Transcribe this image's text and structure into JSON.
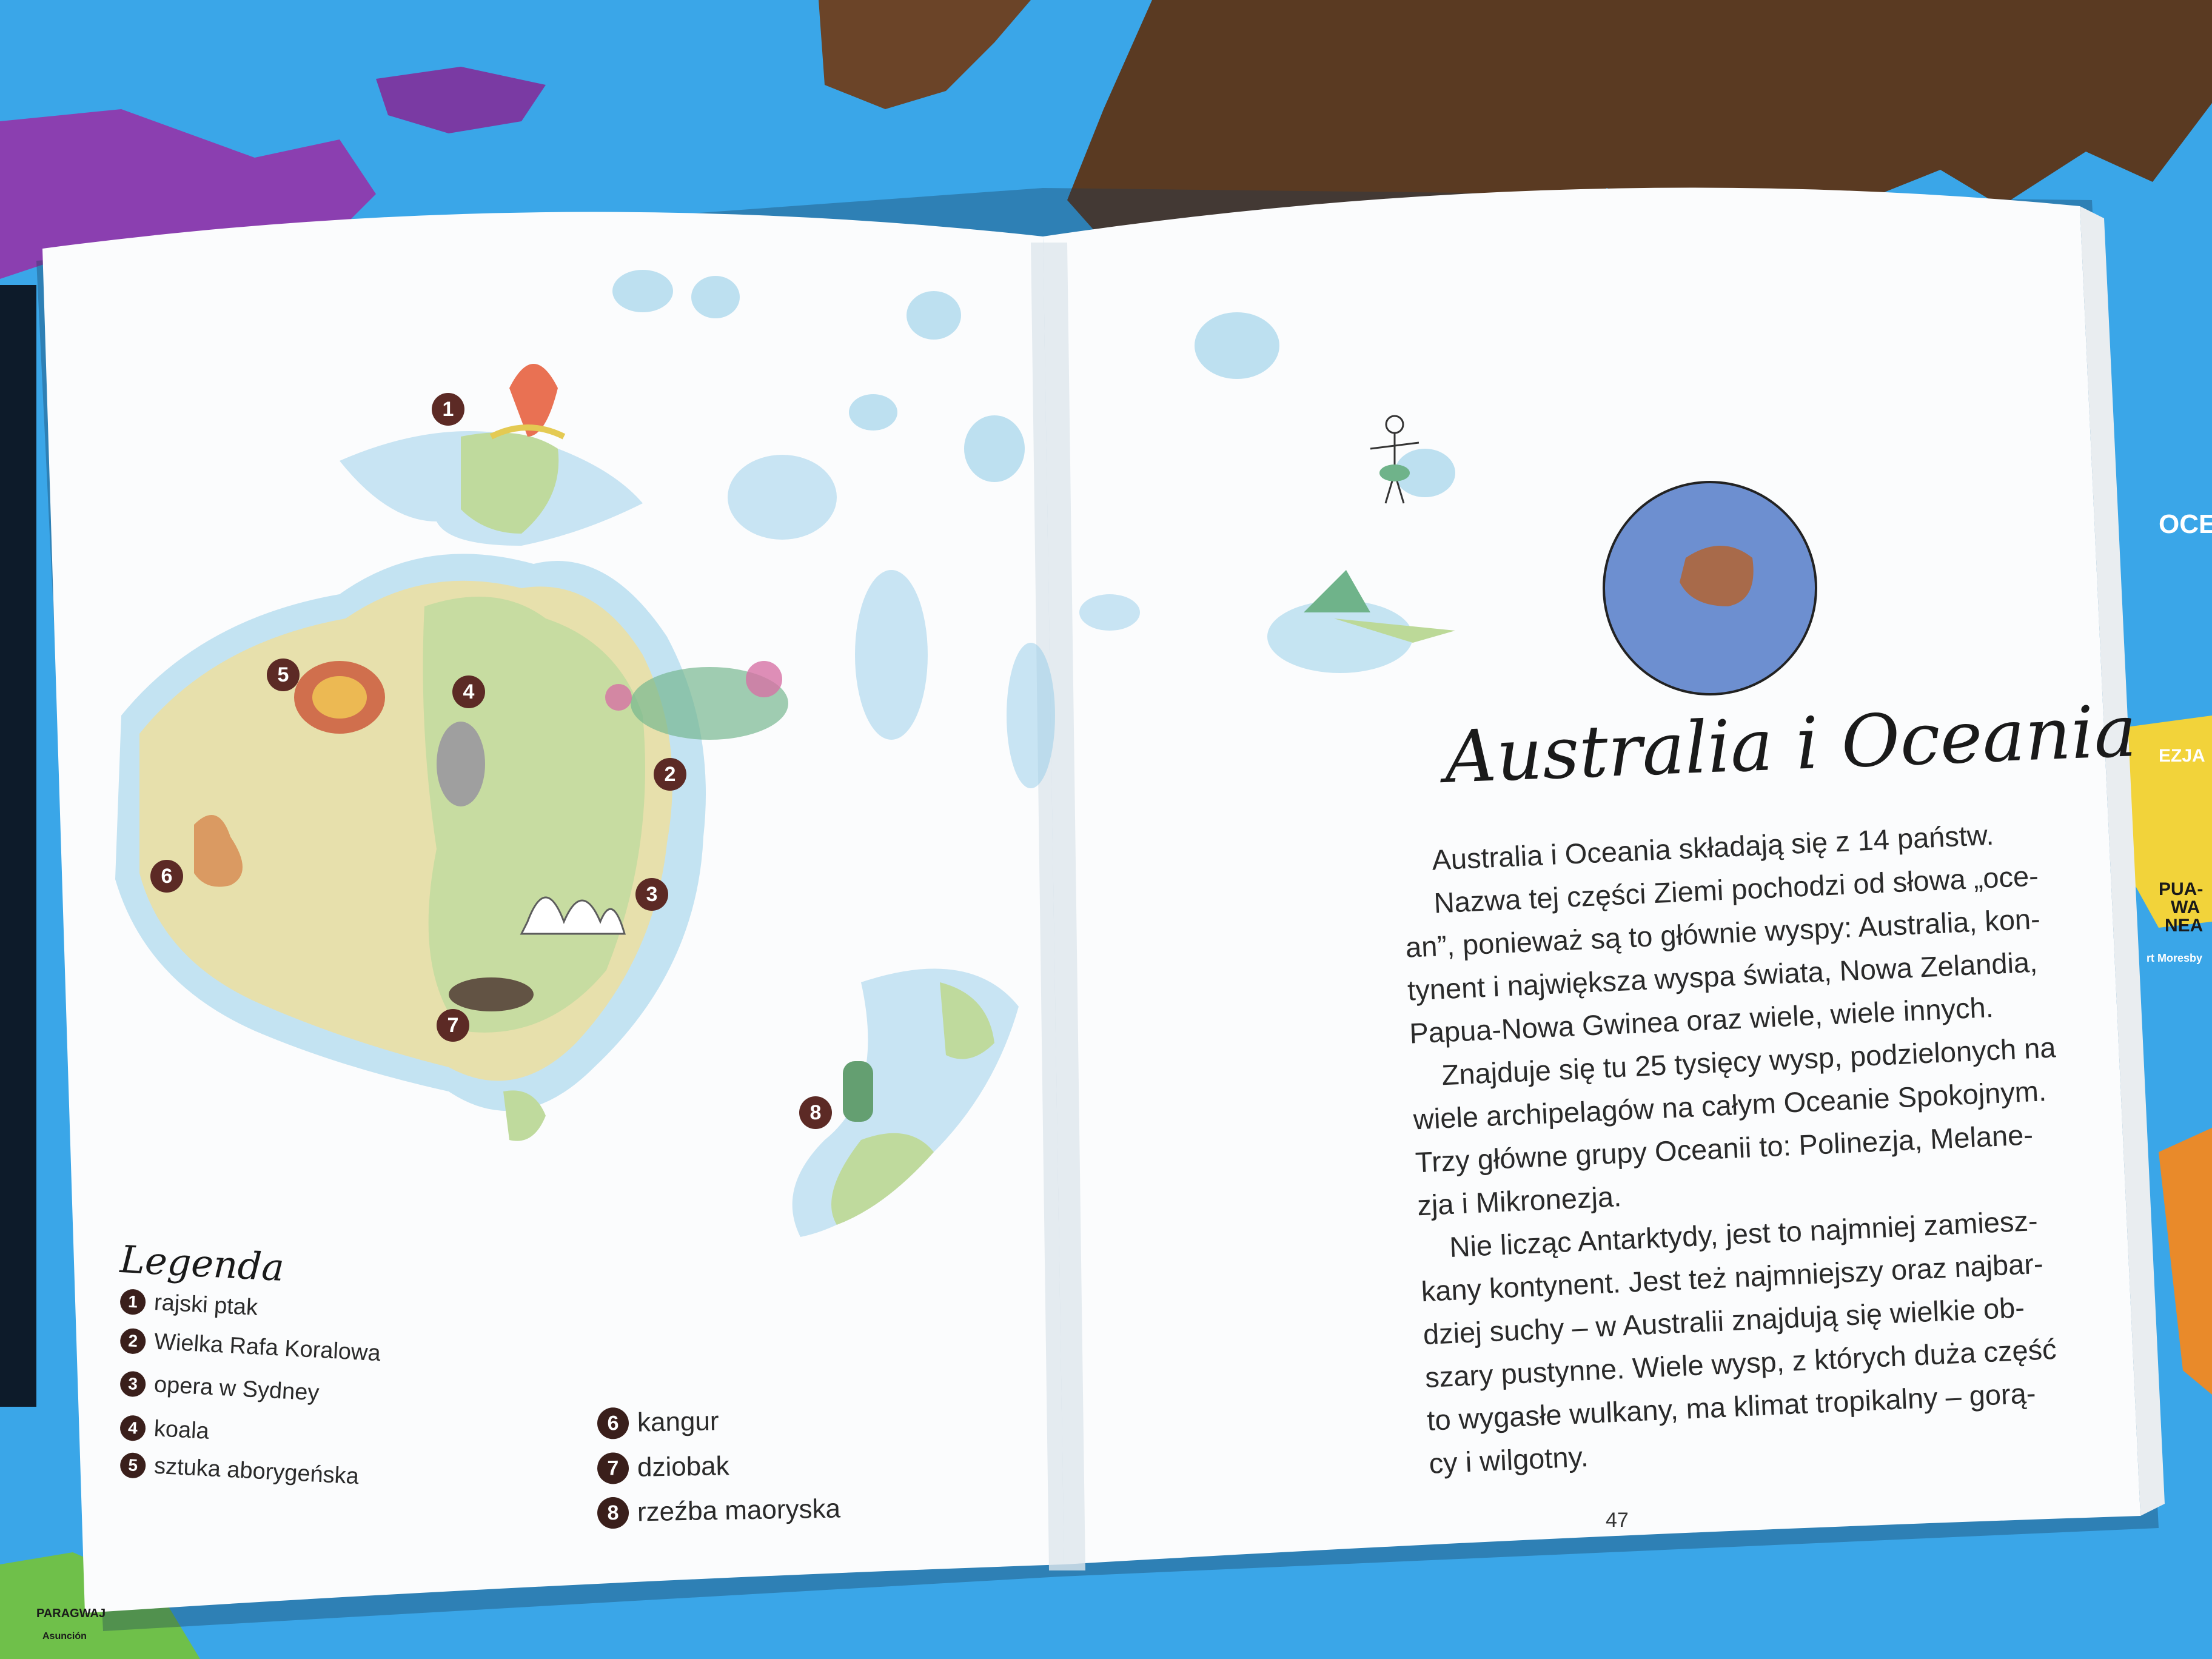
{
  "right_page": {
    "title": "Australia i Oceania",
    "paragraphs": [
      "Australia i Oceania składają się z 14 państw.",
      "Nazwa tej części Ziemi pochodzi od słowa „oce-",
      "an”, ponieważ są to głównie wyspy: Australia, kon-",
      "tynent i największa wyspa świata, Nowa Zelandia,",
      "Papua-Nowa Gwinea oraz wiele, wiele innych.",
      "Znajduje się tu 25 tysięcy wysp, podzielonych na",
      "wiele archipelagów na całym Oceanie Spokojnym.",
      "Trzy główne grupy Oceanii to: Polinezja, Melane-",
      "zja i Mikronezja.",
      "Nie licząc Antarktydy, jest to najmniej zamiesz-",
      "kany kontynent. Jest też najmniejszy oraz najbar-",
      "dziej suchy – w Australii znajdują się wielkie ob-",
      "szary pustynne. Wiele wysp, z których duża część",
      "to wygasłe wulkany, ma klimat tropikalny – gorą-",
      "cy i wilgotny."
    ],
    "page_number": "47"
  },
  "legend": {
    "title": "Legenda",
    "items": [
      {
        "num": "1",
        "label": "rajski ptak"
      },
      {
        "num": "2",
        "label": "Wielka Rafa Koralowa"
      },
      {
        "num": "3",
        "label": "opera w Sydney"
      },
      {
        "num": "4",
        "label": "koala"
      },
      {
        "num": "5",
        "label": "sztuka aborygeńska"
      },
      {
        "num": "6",
        "label": "kangur"
      },
      {
        "num": "7",
        "label": "dziobak"
      },
      {
        "num": "8",
        "label": "rzeźba maoryska"
      }
    ]
  },
  "map_markers": [
    "1",
    "2",
    "3",
    "4",
    "5",
    "6",
    "7",
    "8"
  ],
  "poster_labels": {
    "ocean": "OCEAN",
    "ezja": "EZJA",
    "papua_a": "PUA-",
    "papua_b": "WA",
    "papua_c": "NEA",
    "moresby": "rt Moresby",
    "paragwaj": "PARAGWAJ",
    "asuncion": "Asunción"
  },
  "colors": {
    "poster_ocean": "#3aa6e8",
    "land_brown": "#5a3a22",
    "page_white": "#fbfcfd",
    "marker": "#5c2a25",
    "australia_land": "#e6dfa8",
    "sea_wash": "#8fcbe8"
  }
}
